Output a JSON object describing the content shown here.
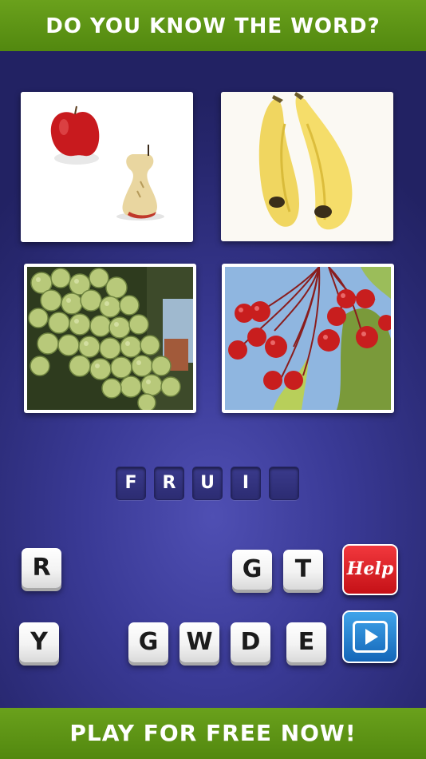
{
  "header": {
    "title": "DO YOU KNOW THE WORD?"
  },
  "footer": {
    "cta": "PLAY FOR FREE NOW!"
  },
  "pictures": [
    {
      "id": "apple",
      "icon": "apple-image"
    },
    {
      "id": "bananas",
      "icon": "banana-image"
    },
    {
      "id": "grapes",
      "icon": "grapes-image"
    },
    {
      "id": "berries",
      "icon": "berries-image"
    }
  ],
  "answer_slots": [
    "F",
    "R",
    "U",
    "I",
    ""
  ],
  "letter_tiles": [
    "R",
    "G",
    "T",
    "Y",
    "G",
    "W",
    "D",
    "E"
  ],
  "buttons": {
    "help_label": "Help",
    "play_icon": "play-icon"
  },
  "colors": {
    "banner_green": "#5c9416",
    "background": "#3a3a96",
    "help_red": "#d9161c",
    "play_blue": "#2a86d6"
  }
}
